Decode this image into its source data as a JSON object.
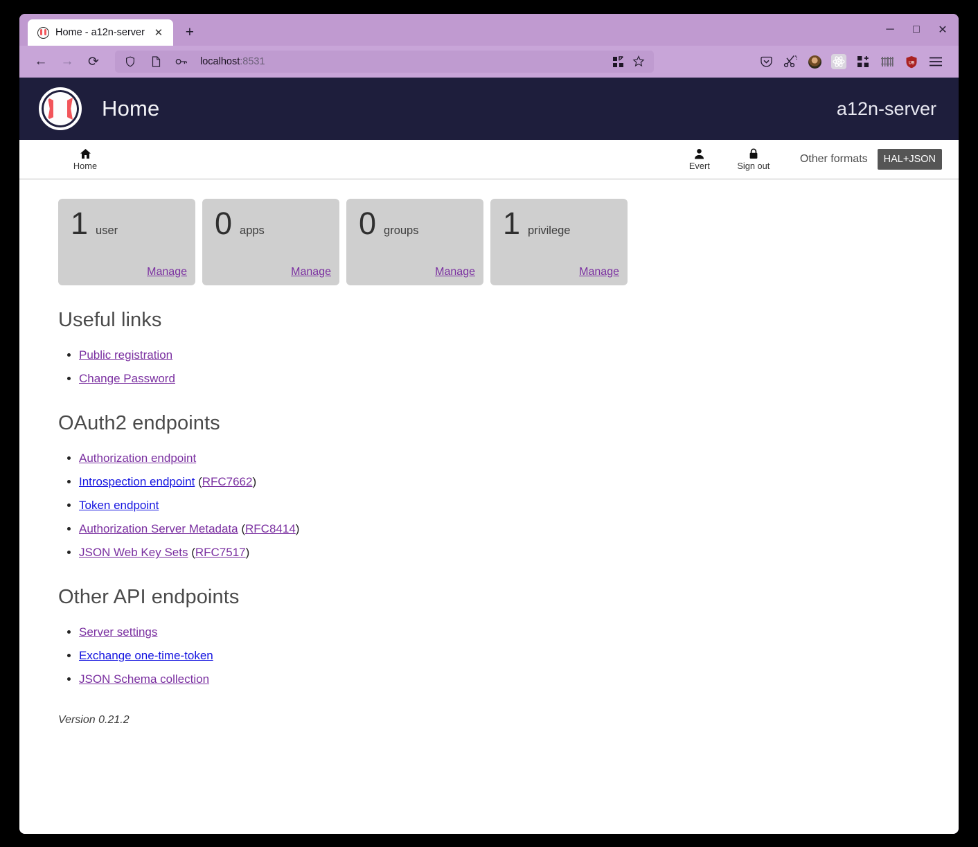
{
  "browser": {
    "tab": {
      "title": "Home - a12n-server",
      "favicon": "a12n-baseball-favicon",
      "close": "✕"
    },
    "newtab": "+",
    "window_controls": {
      "minimize": "─",
      "maximize": "□",
      "close": "✕"
    },
    "nav": {
      "back": "←",
      "forward": "→",
      "reload": "⟳"
    },
    "url": {
      "host": "localhost",
      "port": ":8531"
    },
    "url_icons": [
      "shield-icon",
      "reader-view-icon",
      "key-icon"
    ],
    "url_right_icons": [
      "extensions-icon",
      "bookmark-star-icon"
    ],
    "extensions": [
      "pocket-icon",
      "scissors-icon",
      "account-avatar-icon",
      "react-devtools-icon",
      "extensions-add-icon",
      "barcode-icon",
      "ublock-origin-icon"
    ],
    "menu": "☰"
  },
  "app": {
    "logo_name": "a12n-server-logo",
    "title": "Home",
    "brand": "a12n-server"
  },
  "nav": {
    "home": {
      "label": "Home",
      "icon": "home-icon"
    },
    "user": {
      "label": "Evert",
      "icon": "person-icon"
    },
    "signout": {
      "label": "Sign out",
      "icon": "lock-icon"
    },
    "other_formats_label": "Other formats",
    "format_badge": "HAL+JSON"
  },
  "cards": [
    {
      "count": "1",
      "label": "user",
      "link": "Manage"
    },
    {
      "count": "0",
      "label": "apps",
      "link": "Manage"
    },
    {
      "count": "0",
      "label": "groups",
      "link": "Manage"
    },
    {
      "count": "1",
      "label": "privilege",
      "link": "Manage"
    }
  ],
  "sections": [
    {
      "heading": "Useful links",
      "items": [
        {
          "link": "Public registration",
          "visited": true,
          "suffix": ""
        },
        {
          "link": "Change Password",
          "visited": true,
          "suffix": ""
        }
      ]
    },
    {
      "heading": "OAuth2 endpoints",
      "items": [
        {
          "link": "Authorization endpoint",
          "visited": true,
          "suffix": ""
        },
        {
          "link": "Introspection endpoint",
          "visited": false,
          "suffix": " (",
          "rfc": "RFC7662",
          "suffix2": ")"
        },
        {
          "link": "Token endpoint",
          "visited": false,
          "suffix": ""
        },
        {
          "link": "Authorization Server Metadata",
          "visited": true,
          "suffix": " (",
          "rfc": "RFC8414",
          "suffix2": ")"
        },
        {
          "link": "JSON Web Key Sets",
          "visited": true,
          "suffix": " (",
          "rfc": "RFC7517",
          "suffix2": ")"
        }
      ]
    },
    {
      "heading": "Other API endpoints",
      "items": [
        {
          "link": "Server settings",
          "visited": true,
          "suffix": ""
        },
        {
          "link": "Exchange one-time-token",
          "visited": false,
          "suffix": ""
        },
        {
          "link": "JSON Schema collection",
          "visited": true,
          "suffix": ""
        }
      ]
    }
  ],
  "version": "Version 0.21.2",
  "colors": {
    "header_bg": "#1e1e3c",
    "card_bg": "#cfcfcf",
    "link_visited": "#7a2fa0",
    "link_unvisited": "#1414e0",
    "badge_bg": "#555555",
    "browser_chrome": "#c4a0d4",
    "logo_red": "#f2555a"
  }
}
